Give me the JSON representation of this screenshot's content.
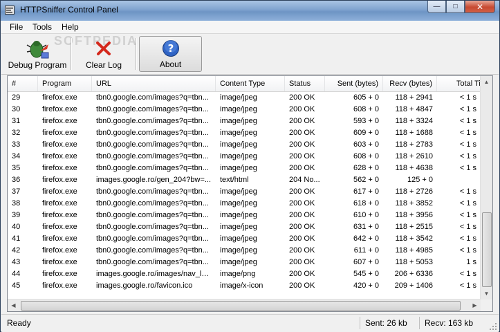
{
  "window": {
    "title": "HTTPSniffer Control Panel"
  },
  "menu": [
    "File",
    "Tools",
    "Help"
  ],
  "toolbar": {
    "debug_label": "Debug Program",
    "clear_label": "Clear Log",
    "about_label": "About",
    "watermark": "SOFTPEDIA"
  },
  "columns": [
    "#",
    "Program",
    "URL",
    "Content Type",
    "Status",
    "Sent (bytes)",
    "Recv (bytes)",
    "Total Tim"
  ],
  "rows": [
    [
      "29",
      "firefox.exe",
      "tbn0.google.com/images?q=tbn...",
      "image/jpeg",
      "200 OK",
      "605 + 0",
      "118 + 2941",
      "< 1 s"
    ],
    [
      "30",
      "firefox.exe",
      "tbn0.google.com/images?q=tbn...",
      "image/jpeg",
      "200 OK",
      "608 + 0",
      "118 + 4847",
      "< 1 s"
    ],
    [
      "31",
      "firefox.exe",
      "tbn0.google.com/images?q=tbn...",
      "image/jpeg",
      "200 OK",
      "593 + 0",
      "118 + 3324",
      "< 1 s"
    ],
    [
      "32",
      "firefox.exe",
      "tbn0.google.com/images?q=tbn...",
      "image/jpeg",
      "200 OK",
      "609 + 0",
      "118 + 1688",
      "< 1 s"
    ],
    [
      "33",
      "firefox.exe",
      "tbn0.google.com/images?q=tbn...",
      "image/jpeg",
      "200 OK",
      "603 + 0",
      "118 + 2783",
      "< 1 s"
    ],
    [
      "34",
      "firefox.exe",
      "tbn0.google.com/images?q=tbn...",
      "image/jpeg",
      "200 OK",
      "608 + 0",
      "118 + 2610",
      "< 1 s"
    ],
    [
      "35",
      "firefox.exe",
      "tbn0.google.com/images?q=tbn...",
      "image/jpeg",
      "200 OK",
      "628 + 0",
      "118 + 4638",
      "< 1 s"
    ],
    [
      "36",
      "firefox.exe",
      "images.google.ro/gen_204?bw=...",
      "text/html",
      "204 No...",
      "562 + 0",
      "125 + 0",
      ""
    ],
    [
      "37",
      "firefox.exe",
      "tbn0.google.com/images?q=tbn...",
      "image/jpeg",
      "200 OK",
      "617 + 0",
      "118 + 2726",
      "< 1 s"
    ],
    [
      "38",
      "firefox.exe",
      "tbn0.google.com/images?q=tbn...",
      "image/jpeg",
      "200 OK",
      "618 + 0",
      "118 + 3852",
      "< 1 s"
    ],
    [
      "39",
      "firefox.exe",
      "tbn0.google.com/images?q=tbn...",
      "image/jpeg",
      "200 OK",
      "610 + 0",
      "118 + 3956",
      "< 1 s"
    ],
    [
      "40",
      "firefox.exe",
      "tbn0.google.com/images?q=tbn...",
      "image/jpeg",
      "200 OK",
      "631 + 0",
      "118 + 2515",
      "< 1 s"
    ],
    [
      "41",
      "firefox.exe",
      "tbn0.google.com/images?q=tbn...",
      "image/jpeg",
      "200 OK",
      "642 + 0",
      "118 + 3542",
      "< 1 s"
    ],
    [
      "42",
      "firefox.exe",
      "tbn0.google.com/images?q=tbn...",
      "image/jpeg",
      "200 OK",
      "611 + 0",
      "118 + 4985",
      "< 1 s"
    ],
    [
      "43",
      "firefox.exe",
      "tbn0.google.com/images?q=tbn...",
      "image/jpeg",
      "200 OK",
      "607 + 0",
      "118 + 5053",
      "1 s"
    ],
    [
      "44",
      "firefox.exe",
      "images.google.ro/images/nav_lo...",
      "image/png",
      "200 OK",
      "545 + 0",
      "206 + 6336",
      "< 1 s"
    ],
    [
      "45",
      "firefox.exe",
      "images.google.ro/favicon.ico",
      "image/x-icon",
      "200 OK",
      "420 + 0",
      "209 + 1406",
      "< 1 s"
    ]
  ],
  "status": {
    "text": "Ready",
    "sent": "Sent: 26 kb",
    "recv": "Recv: 163 kb"
  }
}
